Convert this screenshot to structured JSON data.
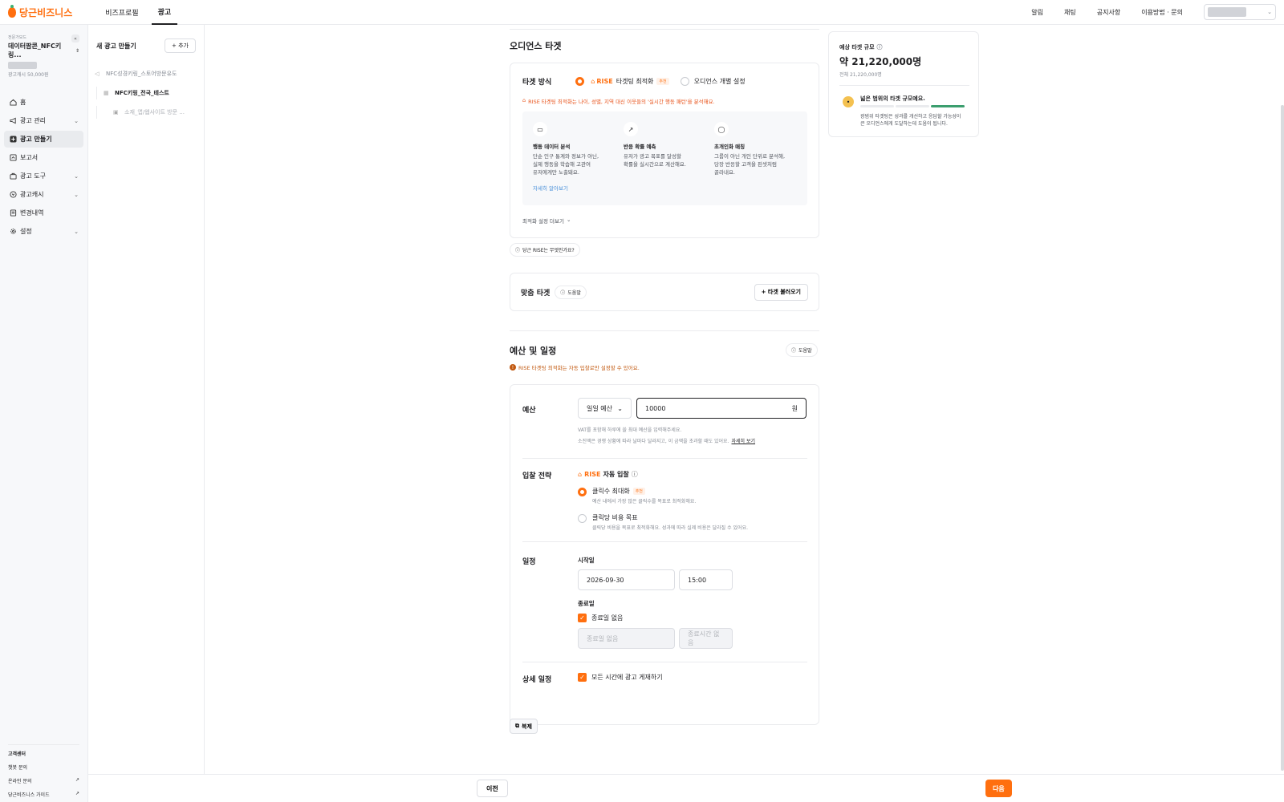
{
  "app": {
    "logo_text": "당근비즈니스"
  },
  "topnav": {
    "items": [
      {
        "label": "비즈프로필",
        "active": false
      },
      {
        "label": "광고",
        "active": true
      }
    ]
  },
  "topright": {
    "links": [
      "알림",
      "채팅",
      "공지사항",
      "이용방법 · 문의"
    ]
  },
  "sidebar": {
    "account_sub": "전문가모드",
    "account_name": "데이터팜콘_NFC키링...",
    "cash": "광고캐시 50,000원",
    "collapse_icon": "«",
    "menu": [
      {
        "label": "홈",
        "icon": "home-icon",
        "caret": false,
        "active": false
      },
      {
        "label": "광고 관리",
        "icon": "megaphone-icon",
        "caret": true,
        "active": false
      },
      {
        "label": "광고 만들기",
        "icon": "plus-square-icon",
        "caret": false,
        "active": true
      },
      {
        "label": "보고서",
        "icon": "report-icon",
        "caret": false,
        "active": false
      },
      {
        "label": "광고 도구",
        "icon": "toolbox-icon",
        "caret": true,
        "active": false
      },
      {
        "label": "광고캐시",
        "icon": "coin-icon",
        "caret": true,
        "active": false
      },
      {
        "label": "변경내역",
        "icon": "history-icon",
        "caret": false,
        "active": false
      },
      {
        "label": "설정",
        "icon": "gear-icon",
        "caret": true,
        "active": false
      }
    ],
    "footer": {
      "title": "고객센터",
      "links": [
        {
          "label": "챗봇 문의",
          "external": false
        },
        {
          "label": "온라인 문의",
          "external": true
        },
        {
          "label": "당근비즈니스 가이드",
          "external": true
        }
      ]
    }
  },
  "treepane": {
    "title": "새 광고 만들기",
    "add_label": "+ 추가",
    "items": [
      {
        "label": "NFC성경키링_스토어방문유도",
        "level": 1
      },
      {
        "label": "NFC키링_전국_테스트",
        "level": 2
      },
      {
        "label": "소재_앱/웹사이트 방문 ...",
        "level": 3
      }
    ]
  },
  "audience": {
    "title": "오디언스 타겟",
    "target_method_label": "타겟 방식",
    "option_rise": "타겟팅 최적화",
    "option_rise_brand": "RISE",
    "recommend_badge": "추천",
    "option_manual": "오디언스 개별 설정",
    "rise_info": "RISE 타겟팅 최적화는 나이, 성별, 지역 대신 이웃들의 '실시간 행동 패턴'을 분석해요.",
    "features": [
      {
        "icon": "chat-icon",
        "title": "행동 데이터 분석",
        "desc": "단순 인구 통계와 정보가 아닌,\n실제 행동을 학습해 고관여\n유저에게만 노출돼요."
      },
      {
        "icon": "trend-up-icon",
        "title": "반응 확률 예측",
        "desc": "유저가 광고 목표를 달성할\n확률을 실시간으로 계산해요."
      },
      {
        "icon": "person-icon",
        "title": "초개인화 매칭",
        "desc": "그룹이 아닌 개인 단위로 분석해,\n당장 반응할 고객을 핀셋처럼\n골라내요."
      }
    ],
    "learn_more": "자세히 알아보기",
    "more_settings": "최적화 설정 더보기",
    "what_is_rise": "당근 RISE는 무엇인가요?"
  },
  "custom_target": {
    "title": "맞춤 타겟",
    "help": "도움말",
    "load_button": "타겟 불러오기"
  },
  "budget_section": {
    "title": "예산 및 일정",
    "help": "도움말",
    "warning": "RISE 타겟팅 최적화는 자동 입찰로만 설정할 수 있어요.",
    "budget_label": "예산",
    "budget_type": "일일 예산",
    "budget_value": "10000",
    "currency": "원",
    "budget_hint1": "VAT를 포함해 하루에 쓸 최대 예산을 입력해주세요.",
    "budget_hint2": "소진액은 경쟁 상황에 따라 날마다 달라지고, 이 금액을 초과할 때도 있어요.",
    "budget_hint_link": "자세히 보기",
    "bid_label": "입찰 전략",
    "bid_brand": "RISE",
    "bid_title": "자동 입찰",
    "bid_options": [
      {
        "label": "클릭수 최대화",
        "desc": "예산 내에서 가장 많은 클릭수를 목표로 최적화해요.",
        "selected": true,
        "badge": "추천"
      },
      {
        "label": "클릭당 비용 목표",
        "desc": "클릭당 비용을 목표로 최적화해요. 성과에 따라 실제 비용은 달라질 수 있어요.",
        "selected": false,
        "badge": ""
      }
    ],
    "schedule_label": "일정",
    "start_label": "시작일",
    "start_date": "2026-09-30",
    "start_time": "15:00",
    "end_label": "종료일",
    "no_end_label": "종료일 없음",
    "end_date_placeholder": "종료일 없음",
    "end_time_placeholder": "종료시간 없음",
    "detail_label": "상세 일정",
    "all_time_label": "모든 시간에 광고 게재하기",
    "copy_button": "복제"
  },
  "side_panel": {
    "title": "예상 타겟 규모",
    "value": "약 21,220,000명",
    "sub": "전체 21,220,000명",
    "status_title": "넓은 범위의 타겟 규모예요.",
    "status_desc": "광범위 타겟팅은 성과를 개선하고 응답할 가능성이\n큰 오디언스에게 도달하는데 도움이 됩니다.",
    "gauge_level": 3
  },
  "footer": {
    "prev": "이전",
    "next": "다음"
  },
  "colors": {
    "accent": "#ff6f0f",
    "link": "#4a90d9"
  }
}
